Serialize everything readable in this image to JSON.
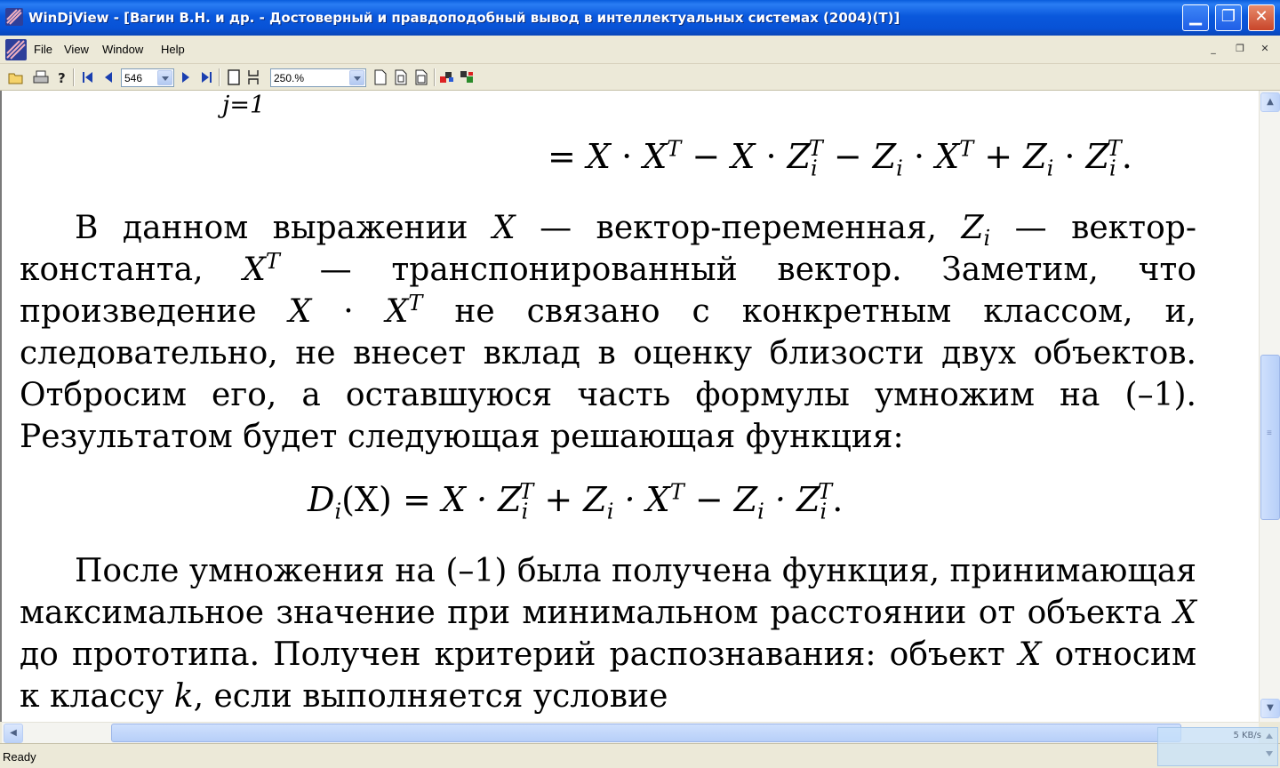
{
  "window": {
    "title": "WinDjView - [Вагин В.Н. и др. - Достоверный и правдоподобный вывод в интеллектуальных системах (2004)(T)]",
    "min_glyph": "▁",
    "max_glyph": "❐",
    "close_glyph": "✕"
  },
  "menu": {
    "items": [
      "File",
      "View",
      "Window",
      "Help"
    ],
    "mdi_min": "_",
    "mdi_restore": "❐",
    "mdi_close": "✕"
  },
  "toolbar": {
    "page_number": "546",
    "zoom": "250.%",
    "icons": [
      "open-icon",
      "print-icon",
      "help-icon",
      "first-page-icon",
      "prev-page-icon",
      "next-page-icon",
      "last-page-icon",
      "single-page-icon",
      "continuous-icon",
      "fit-width-icon",
      "fit-page-icon",
      "actual-size-icon",
      "display-color-icon",
      "display-mask-icon"
    ]
  },
  "document": {
    "sum_limit": "j=1",
    "eq1": {
      "text": "= X · X",
      "parts": [
        "=",
        "X",
        "·",
        "X",
        "T",
        "−",
        "X",
        "·",
        "Z",
        "i",
        "T",
        "−",
        "Z",
        "i",
        "·",
        "X",
        "T",
        "+",
        "Z",
        "i",
        "·",
        "Z",
        "i",
        "T",
        "."
      ]
    },
    "para1": {
      "lead": "В данном выражении",
      "x": "X",
      "dash1": "— вектор-переменная,",
      "zi": "Z",
      "zi_sub": "i",
      "dash2": "— вектор-константа,",
      "xt": "X",
      "xt_sup": "T",
      "rest1": "— транспонированный вектор. Заметим, что произведение",
      "x2": "X",
      "dot": "·",
      "x3": "X",
      "x3_sup": "T",
      "rest2": "не связано с конкретным классом, и, следовательно, не внесет вклад в оценку близости двух объектов. Отбросим его, а оставшуюся часть формулы умножим на (–1). Результатом будет следующая решающая функция:"
    },
    "eq2": {
      "lhs": "D",
      "lhs_sub": "i",
      "lhs_arg": "(X) =",
      "t1": "X · Z",
      "t1_sub": "i",
      "t1_sup": "T",
      "t2": "+ Z",
      "t2_sub": "i",
      "t2b": "· X",
      "t2_sup": "T",
      "t3": "− Z",
      "t3_sub": "i",
      "t3b": "· Z",
      "t3c_sub": "i",
      "t3_sup": "T",
      "end": "."
    },
    "para2": {
      "lead": "После умножения на (–1) была получена функция, принимающая максимальное значение при минимальном расстоянии от объекта",
      "x": "X",
      "mid": "до прототипа. Получен критерий распознавания: объект",
      "x2": "X",
      "mid2": "относим к классу",
      "k": "k",
      "end": ", если выполняется условие"
    }
  },
  "scrollbar": {
    "up": "▲",
    "down": "▼",
    "left": "◀",
    "right": "▶",
    "grip": "≡",
    "vthumb_position": 0.575,
    "hthumb_start": 0.087
  },
  "status": {
    "text": "Ready",
    "net_rate": "5 KB/s"
  }
}
